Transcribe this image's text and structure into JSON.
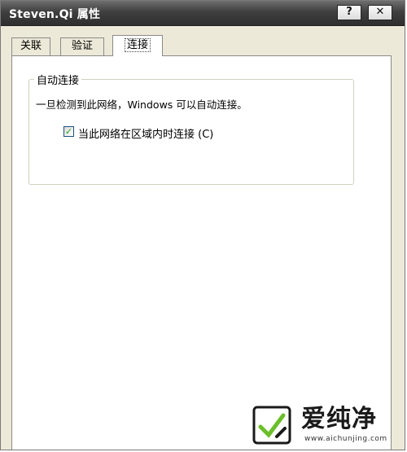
{
  "window": {
    "title": "Steven.Qi 属性",
    "help_label": "?",
    "close_label": "✕"
  },
  "tabs": [
    {
      "label": "关联"
    },
    {
      "label": "验证"
    },
    {
      "label": "连接",
      "selected": true
    }
  ],
  "group": {
    "legend": "自动连接",
    "description": "一旦检测到此网络，Windows 可以自动连接。",
    "checkbox": {
      "label": "当此网络在区域内时连接 (C)",
      "checked": true
    }
  },
  "watermark": {
    "brand": "爱纯净",
    "url": "www.aichunjing.com",
    "accent_color": "#6bbf2a"
  }
}
